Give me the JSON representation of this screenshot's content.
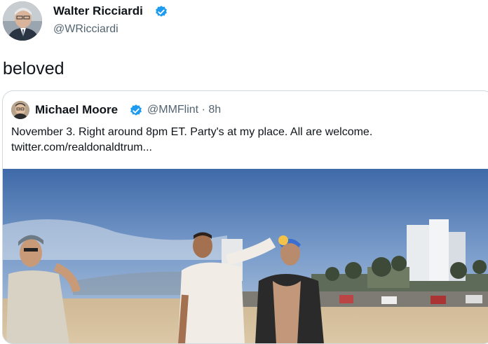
{
  "tweet": {
    "author_name": "Walter Ricciardi",
    "author_handle": "@WRicciardi",
    "text": "beloved",
    "verified": true
  },
  "quoted_tweet": {
    "author_name": "Michael Moore",
    "author_handle": "@MMFlint",
    "separator": "·",
    "time": "8h",
    "verified": true,
    "text_line1": "November 3.  Right around 8pm ET. Party's at my place. All are welcome.",
    "link_text": "twitter.com/realdonaldtrum...",
    "media": "video-still-beach-scene"
  },
  "colors": {
    "verified_blue": "#1d9bf0",
    "handle_gray": "#536471",
    "border": "#cfd9de"
  },
  "icons": {
    "verified": "verified-badge-icon"
  }
}
